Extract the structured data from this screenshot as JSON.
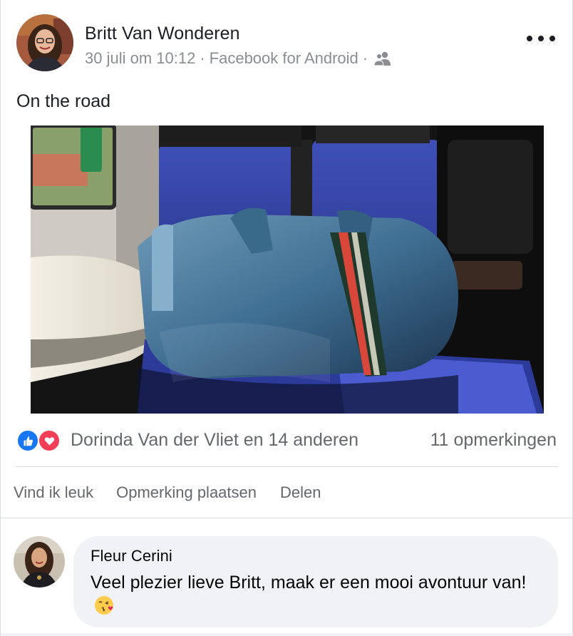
{
  "post": {
    "author_name": "Britt Van Wonderen",
    "date": "30 juli om 10:12",
    "separator": "·",
    "source": "Facebook for Android",
    "audience_icon": "friends-icon",
    "more_icon": "more-horizontal-icon",
    "text": "On the road"
  },
  "reactions": {
    "icons": [
      "like-icon",
      "love-icon"
    ],
    "summary": "Dorinda Van der Vliet en 14 anderen",
    "comments": "11 opmerkingen"
  },
  "actions": {
    "like": "Vind ik leuk",
    "comment": "Opmerking plaatsen",
    "share": "Delen"
  },
  "comment": {
    "author_name": "Fleur Cerini",
    "text": "Veel plezier lieve Britt, maak er een mooi avontuur van!",
    "emoji": "kissing-heart-emoji"
  },
  "colors": {
    "like": "#1877f2",
    "love": "#f33e58",
    "secondary_text": "#65676b",
    "meta_text": "#8a8d91",
    "bubble": "#f0f2f5"
  }
}
